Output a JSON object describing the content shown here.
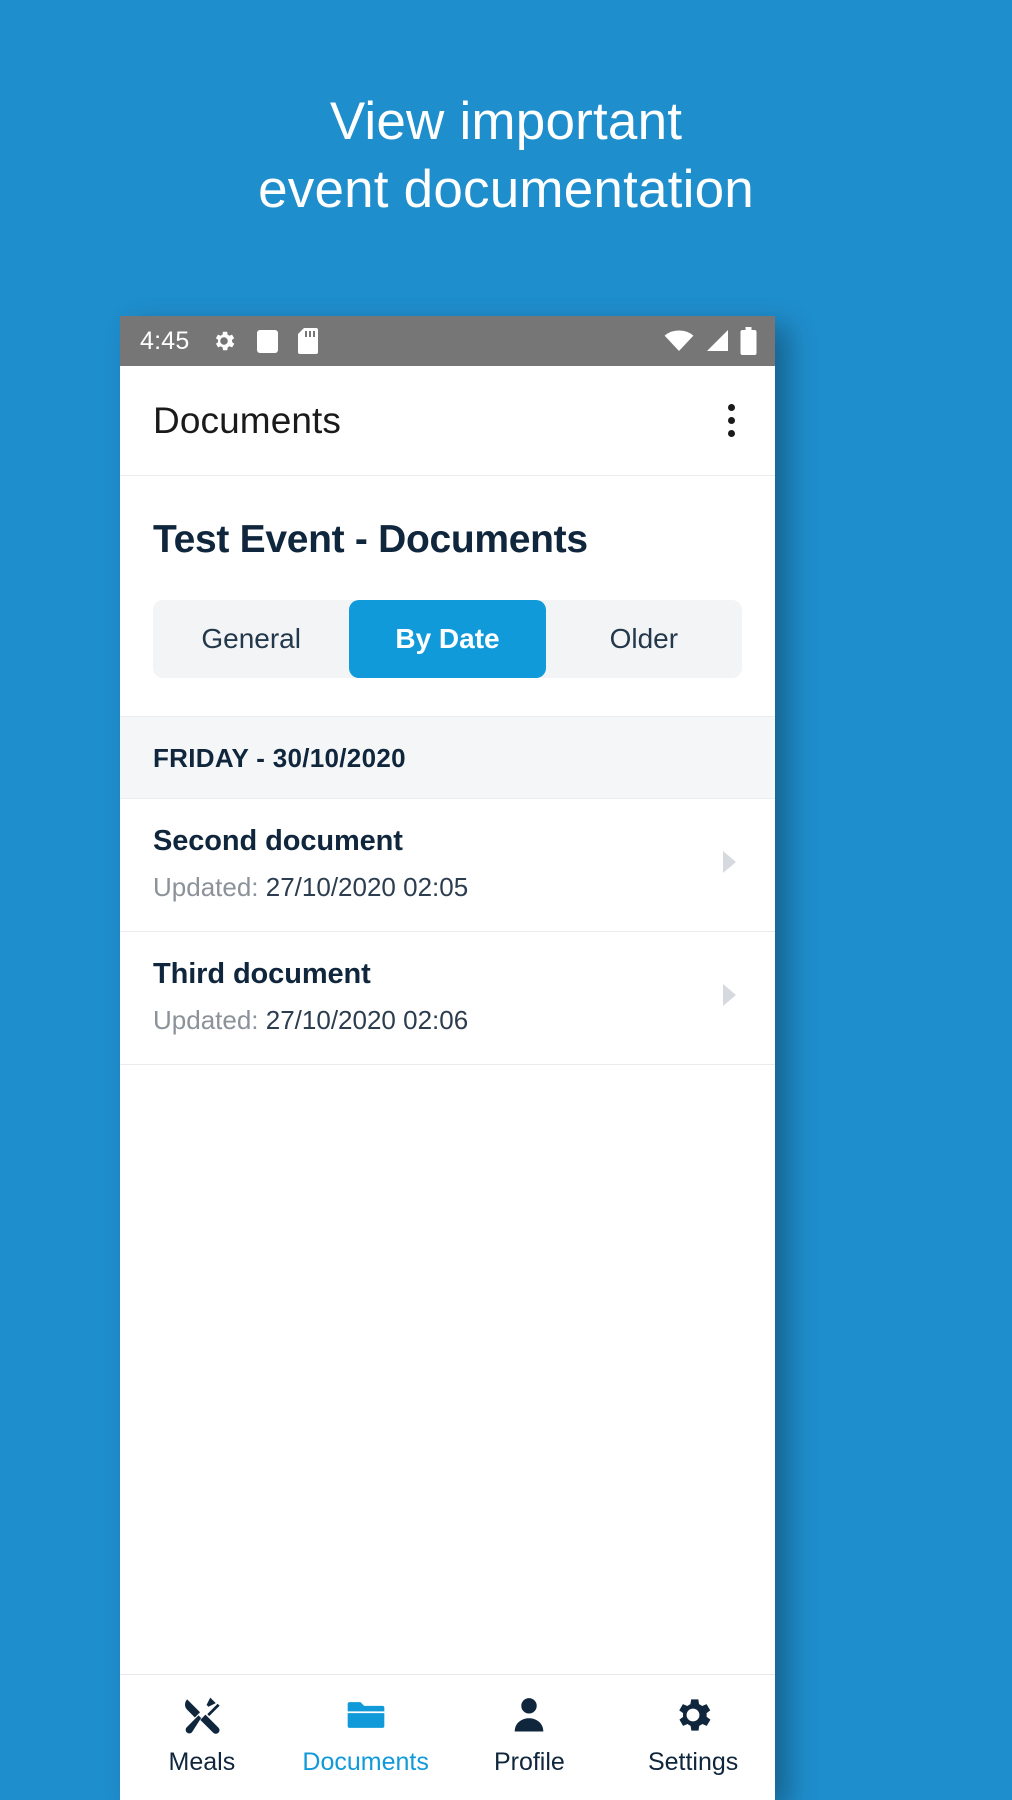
{
  "promo": {
    "line1": "View important",
    "line2": "event documentation"
  },
  "colors": {
    "background_blue": "#1f8ecd",
    "accent_blue": "#119ad9",
    "dark_navy": "#10263c",
    "statusbar_gray": "#767676",
    "section_gray": "#f4f6f7"
  },
  "statusbar": {
    "clock": "4:45",
    "left_icons": [
      "gear-icon",
      "square-icon",
      "sd-card-icon"
    ],
    "right_icons": [
      "wifi-icon",
      "signal-icon",
      "battery-icon"
    ]
  },
  "appbar": {
    "title": "Documents",
    "overflow_icon": "kebab-menu-icon"
  },
  "header": {
    "event_title": "Test Event - Documents",
    "tabs": [
      {
        "label": "General",
        "active": false
      },
      {
        "label": "By Date",
        "active": true
      },
      {
        "label": "Older",
        "active": false
      }
    ]
  },
  "list": {
    "section_header": "FRIDAY - 30/10/2020",
    "updated_label": "Updated:",
    "rows": [
      {
        "title": "Second document",
        "updated_value": "27/10/2020 02:05"
      },
      {
        "title": "Third document",
        "updated_value": "27/10/2020 02:06"
      }
    ]
  },
  "bottom_nav": {
    "items": [
      {
        "label": "Meals",
        "icon": "cutlery-icon",
        "active": false
      },
      {
        "label": "Documents",
        "icon": "folder-icon",
        "active": true
      },
      {
        "label": "Profile",
        "icon": "person-icon",
        "active": false
      },
      {
        "label": "Settings",
        "icon": "gear-icon",
        "active": false
      }
    ]
  }
}
